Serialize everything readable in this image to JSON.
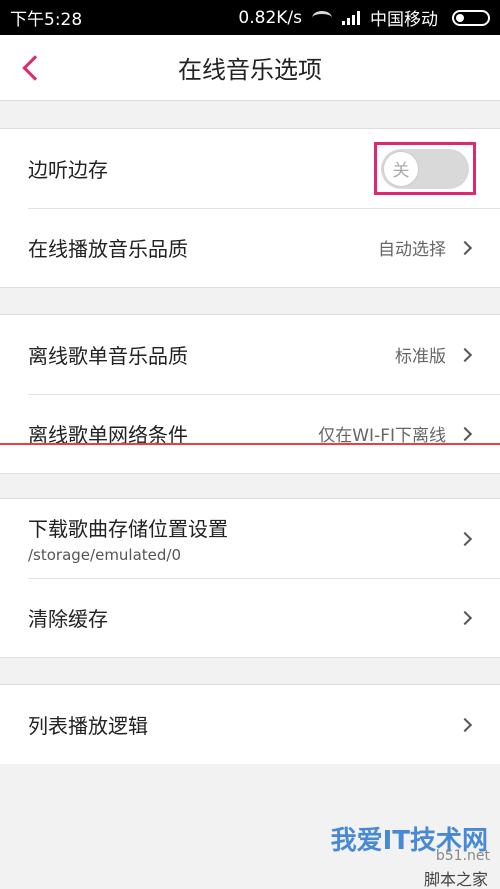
{
  "statusbar": {
    "time": "下午5:28",
    "speed": "0.82K/s",
    "carrier": "中国移动"
  },
  "navbar": {
    "title": "在线音乐选项"
  },
  "settings": {
    "listen_and_save": {
      "label": "边听边存",
      "toggle_state": "关",
      "enabled": false
    },
    "online_quality": {
      "label": "在线播放音乐品质",
      "value": "自动选择"
    },
    "offline_quality": {
      "label": "离线歌单音乐品质",
      "value": "标准版"
    },
    "offline_network": {
      "label": "离线歌单网络条件",
      "value": "仅在WI-FI下离线"
    },
    "download_location": {
      "label": "下载歌曲存储位置设置",
      "path": "/storage/emulated/0"
    },
    "clear_cache": {
      "label": "清除缓存"
    },
    "list_playback": {
      "label": "列表播放逻辑"
    }
  },
  "watermark": {
    "brand": "我爱IT技术网",
    "site": "b51.net",
    "sub": "脚本之家"
  },
  "colors": {
    "accent": "#e0286e",
    "annotation_line": "#e04444"
  }
}
